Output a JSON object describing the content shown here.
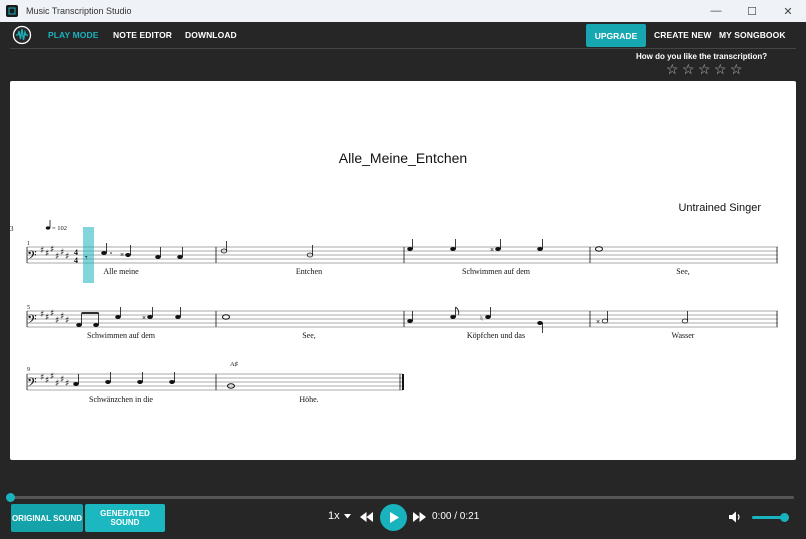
{
  "window": {
    "title": "Music Transcription Studio",
    "minimize": "—",
    "maximize": "☐",
    "close": "✕"
  },
  "nav": {
    "play_mode": "PLAY MODE",
    "note_editor": "NOTE EDITOR",
    "download": "DOWNLOAD",
    "upgrade": "UPGRADE",
    "create_new": "CREATE NEW",
    "my_songbook": "MY SONGBOOK"
  },
  "rating": {
    "question": "How do you like the transcription?",
    "stars": [
      "☆",
      "☆",
      "☆",
      "☆",
      "☆"
    ],
    "value": 0
  },
  "score": {
    "title": "Alle_Meine_Entchen",
    "composer": "Untrained Singer",
    "tempo": "= 102",
    "header_mark": "3",
    "chord": "A♯",
    "measure_numbers": [
      "1",
      "5",
      "9"
    ],
    "lyrics_row1": [
      "Alle meine",
      "Entchen",
      "Schwimmen auf dem",
      "See,"
    ],
    "lyrics_row2": [
      "Schwimmen auf dem",
      "See,",
      "Köpfchen und das",
      "Wasser"
    ],
    "lyrics_row3": [
      "Schwänzchen in die",
      "Höhe."
    ]
  },
  "controls": {
    "original_sound": "ORIGINAL SOUND",
    "generated_sound": "GENERATED SOUND",
    "speed": "1x",
    "time": "0:00 / 0:21",
    "progress": 0,
    "volume": 1.0,
    "accent": "#19b3bd"
  }
}
